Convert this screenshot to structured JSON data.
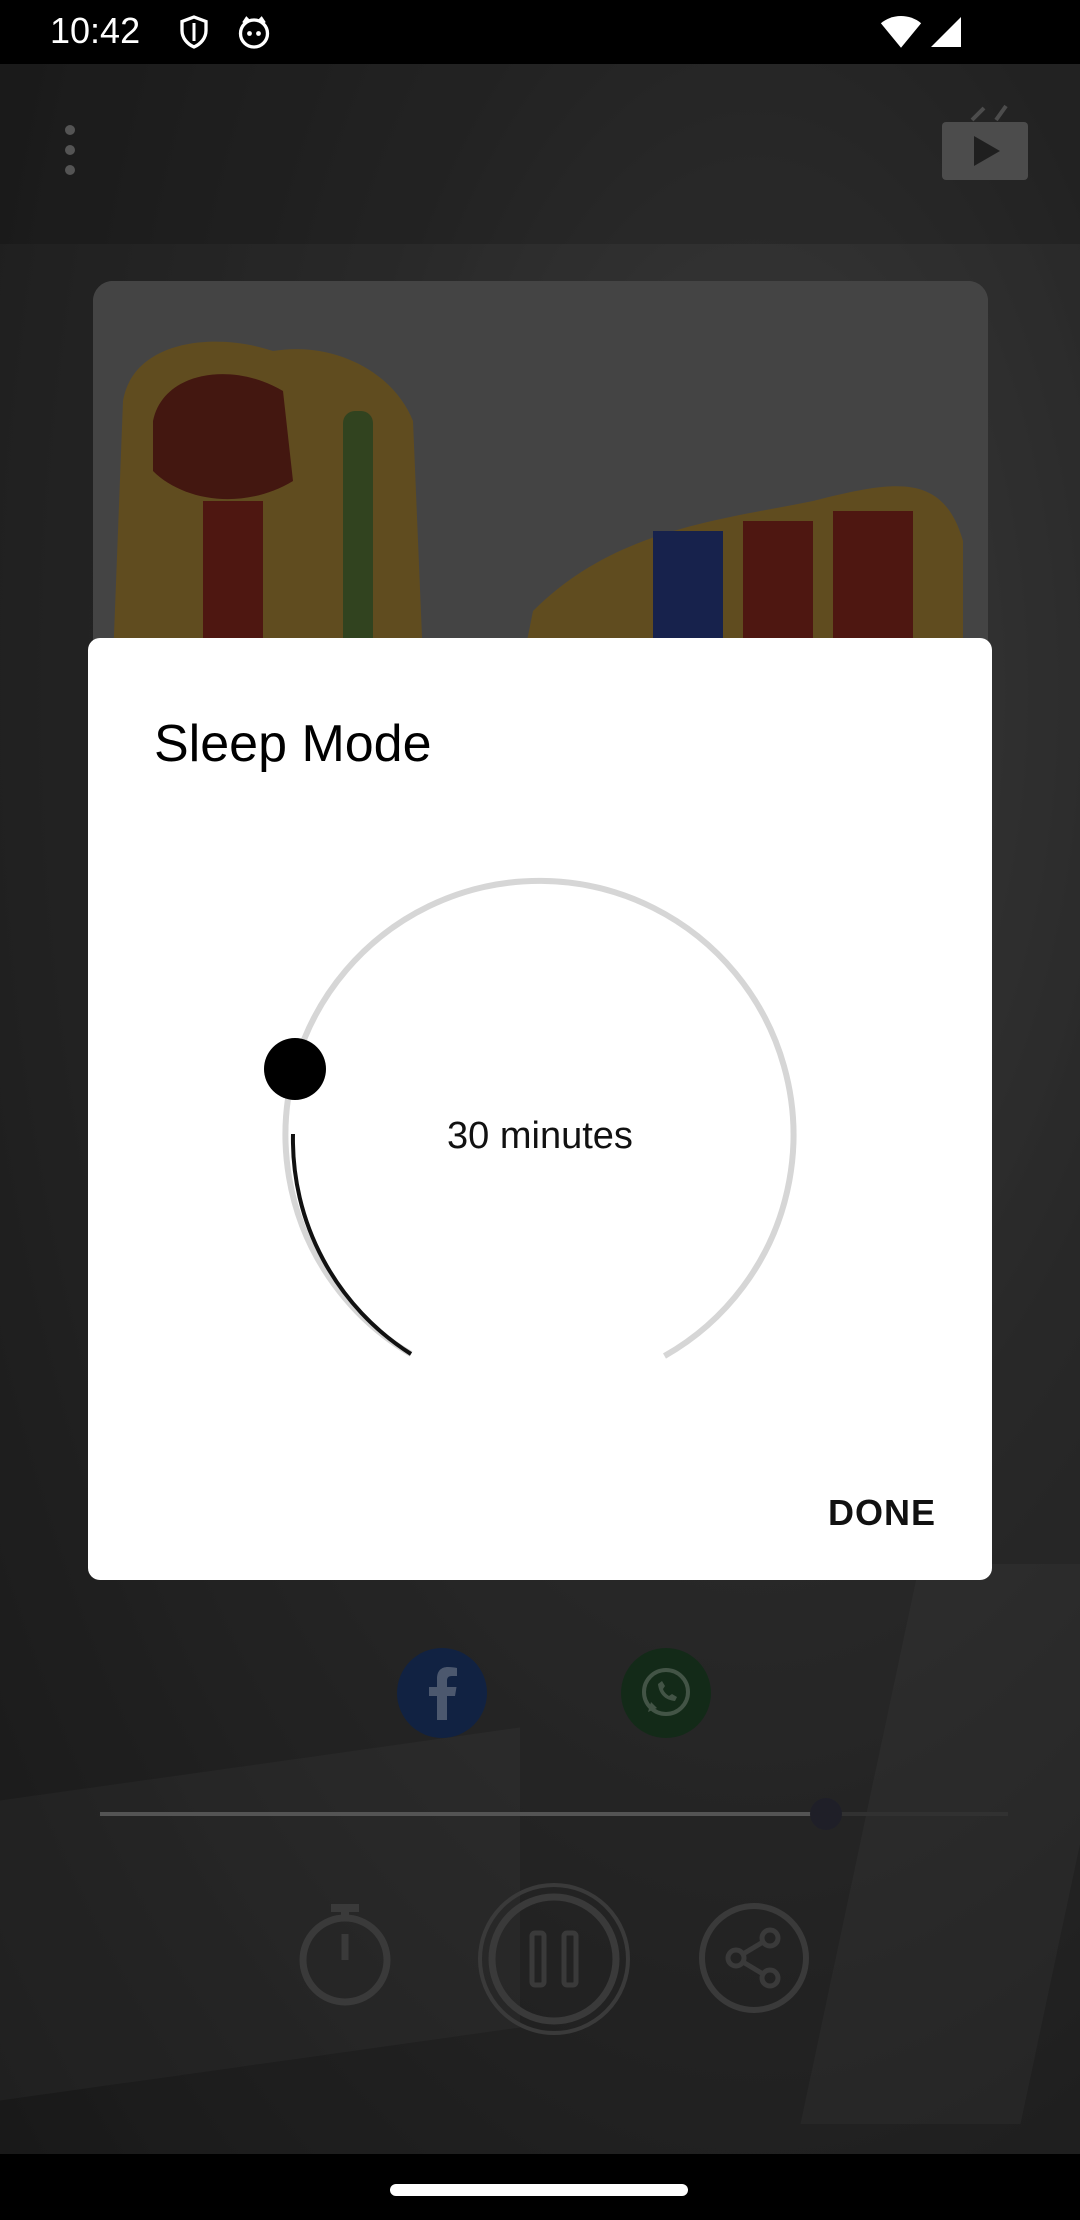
{
  "status_bar": {
    "time": "10:42",
    "icons": [
      "shield-icon",
      "cat-icon",
      "wifi-icon",
      "signal-icon"
    ]
  },
  "player": {
    "menu_icon": "more-vert-icon",
    "cast_icon": "cast-icon",
    "progress_fraction": 0.8,
    "social": [
      "facebook-icon",
      "whatsapp-icon"
    ],
    "controls": [
      "timer-icon",
      "pause-icon",
      "share-icon"
    ]
  },
  "sleep_dialog": {
    "title": "Sleep Mode",
    "value_text": "30 minutes",
    "done_label": "DONE"
  },
  "colors": {
    "facebook": "#1f4e9c",
    "whatsapp": "#2e6b3a",
    "dialog_bg": "#ffffff"
  }
}
